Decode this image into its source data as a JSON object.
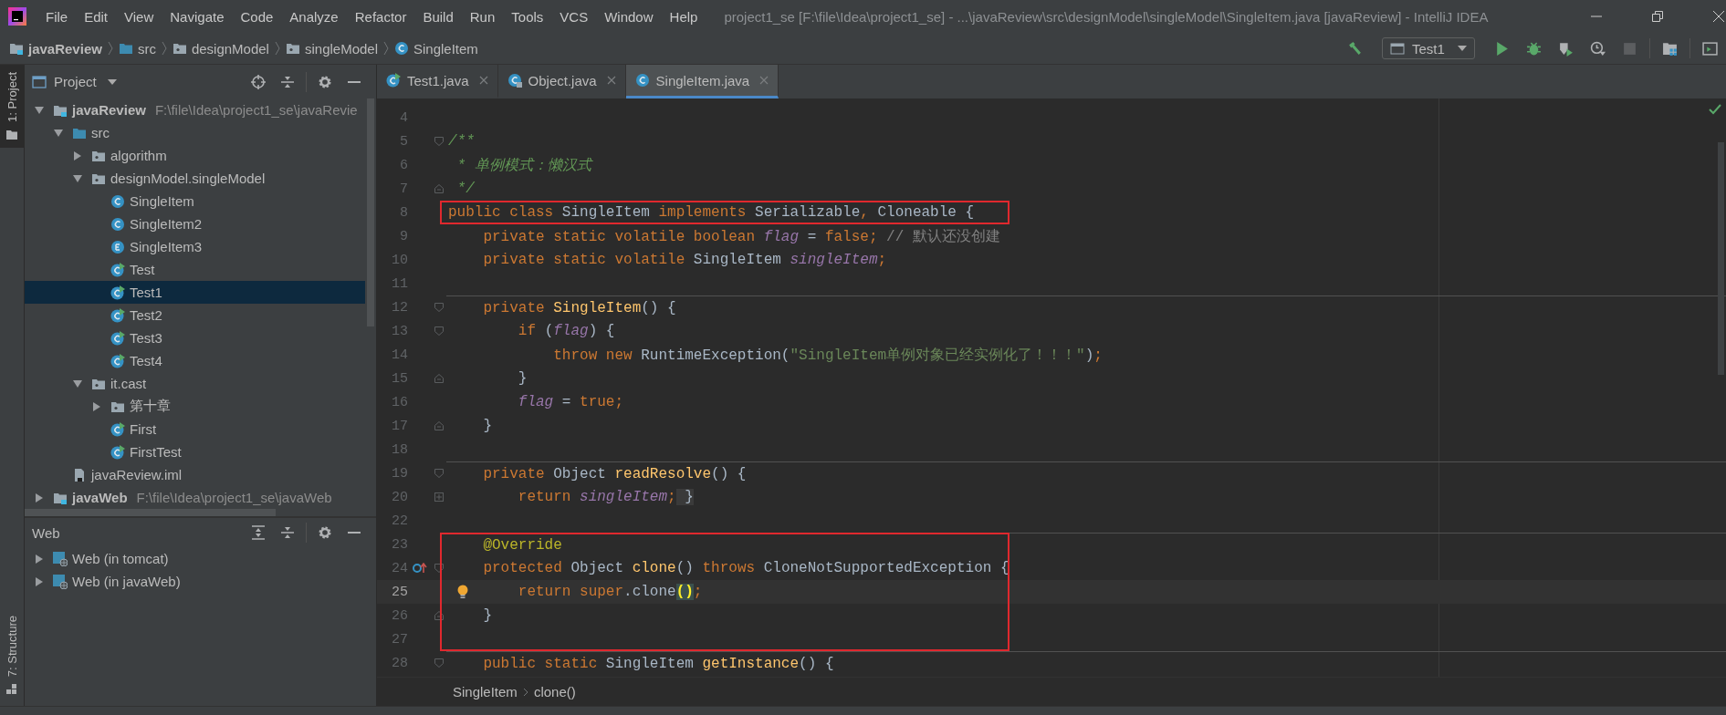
{
  "window": {
    "title": "project1_se [F:\\file\\Idea\\project1_se] - ...\\javaReview\\src\\designModel\\singleModel\\SingleItem.java [javaReview] - IntelliJ IDEA",
    "menu": [
      "File",
      "Edit",
      "View",
      "Navigate",
      "Code",
      "Analyze",
      "Refactor",
      "Build",
      "Run",
      "Tools",
      "VCS",
      "Window",
      "Help"
    ]
  },
  "nav_bar": {
    "breadcrumbs": [
      {
        "label": "javaReview",
        "kind": "module"
      },
      {
        "label": "src",
        "kind": "source-folder"
      },
      {
        "label": "designModel",
        "kind": "package"
      },
      {
        "label": "singleModel",
        "kind": "package"
      },
      {
        "label": "SingleItem",
        "kind": "class"
      }
    ],
    "run_config": "Test1"
  },
  "tool_strip": {
    "tabs": [
      {
        "label": "1: Project",
        "selected": true
      },
      {
        "label": "7: Structure",
        "selected": false
      }
    ]
  },
  "project_panel": {
    "title": "Project",
    "tree": [
      {
        "label": "javaReview",
        "kind": "module",
        "path": "F:\\file\\Idea\\project1_se\\javaRevie",
        "expanded": true,
        "selected": false,
        "children": [
          {
            "label": "src",
            "kind": "source-folder",
            "expanded": true,
            "selected": false,
            "children": [
              {
                "label": "algorithm",
                "kind": "package",
                "expanded": false,
                "selected": false
              },
              {
                "label": "designModel.singleModel",
                "kind": "package",
                "expanded": true,
                "selected": false,
                "children": [
                  {
                    "label": "SingleItem",
                    "kind": "class",
                    "selected": false
                  },
                  {
                    "label": "SingleItem2",
                    "kind": "class",
                    "selected": false
                  },
                  {
                    "label": "SingleItem3",
                    "kind": "enum",
                    "selected": false
                  },
                  {
                    "label": "Test",
                    "kind": "runnable",
                    "selected": false
                  },
                  {
                    "label": "Test1",
                    "kind": "runnable",
                    "selected": true
                  },
                  {
                    "label": "Test2",
                    "kind": "runnable",
                    "selected": false
                  },
                  {
                    "label": "Test3",
                    "kind": "runnable",
                    "selected": false
                  },
                  {
                    "label": "Test4",
                    "kind": "runnable",
                    "selected": false
                  }
                ]
              },
              {
                "label": "it.cast",
                "kind": "package",
                "expanded": true,
                "selected": false,
                "children": [
                  {
                    "label": "第十章",
                    "kind": "package",
                    "expanded": false,
                    "selected": false
                  },
                  {
                    "label": "First",
                    "kind": "runnable",
                    "selected": false
                  },
                  {
                    "label": "FirstTest",
                    "kind": "runnable",
                    "selected": false
                  }
                ]
              }
            ]
          },
          {
            "label": "javaReview.iml",
            "kind": "iml",
            "selected": false
          }
        ]
      },
      {
        "label": "javaWeb",
        "kind": "module",
        "path": "F:\\file\\Idea\\project1_se\\javaWeb",
        "expanded": false,
        "selected": false
      }
    ]
  },
  "web_panel": {
    "title": "Web",
    "items": [
      {
        "label": "Web (in tomcat)",
        "expanded": false
      },
      {
        "label": "Web (in javaWeb)",
        "expanded": false
      }
    ]
  },
  "editor": {
    "tabs": [
      {
        "label": "Test1.java",
        "kind": "runnable",
        "selected": false
      },
      {
        "label": "Object.java",
        "kind": "locked-class",
        "selected": false
      },
      {
        "label": "SingleItem.java",
        "kind": "class",
        "selected": true
      }
    ],
    "lines": [
      {
        "number": "4"
      },
      {
        "number": "5",
        "fold_start": true,
        "tokens": [
          {
            "text": "/**",
            "kind": "doc"
          }
        ]
      },
      {
        "number": "6",
        "tokens": [
          {
            "text": " * 单例模式：懒汉式",
            "kind": "doc"
          }
        ]
      },
      {
        "number": "7",
        "fold_end": true,
        "tokens": [
          {
            "text": " */",
            "kind": "doc"
          }
        ]
      },
      {
        "number": "8",
        "boxed": true,
        "tokens": [
          {
            "text": "public class ",
            "kind": "kw"
          },
          {
            "text": "SingleItem ",
            "kind": "plain"
          },
          {
            "text": "implements ",
            "kind": "kw"
          },
          {
            "text": "Serializable",
            "kind": "plain"
          },
          {
            "text": ", ",
            "kind": "kw"
          },
          {
            "text": "Cloneable {",
            "kind": "plain"
          }
        ]
      },
      {
        "number": "9",
        "tokens": [
          {
            "text": "    private static volatile boolean ",
            "kind": "kw"
          },
          {
            "text": "flag",
            "kind": "field"
          },
          {
            "text": " = ",
            "kind": "plain"
          },
          {
            "text": "false;",
            "kind": "kw"
          },
          {
            "text": " // 默认还没创建",
            "kind": "cmt"
          }
        ]
      },
      {
        "number": "10",
        "tokens": [
          {
            "text": "    private static volatile ",
            "kind": "kw"
          },
          {
            "text": "SingleItem ",
            "kind": "plain"
          },
          {
            "text": "singleItem",
            "kind": "field"
          },
          {
            "text": ";",
            "kind": "kw"
          }
        ]
      },
      {
        "number": "11"
      },
      {
        "number": "12",
        "separator": true,
        "fold_start": true,
        "tokens": [
          {
            "text": "    private ",
            "kind": "kw"
          },
          {
            "text": "SingleItem",
            "kind": "fn"
          },
          {
            "text": "() {",
            "kind": "plain"
          }
        ]
      },
      {
        "number": "13",
        "fold_start": true,
        "tokens": [
          {
            "text": "        if ",
            "kind": "kw"
          },
          {
            "text": "(",
            "kind": "plain"
          },
          {
            "text": "flag",
            "kind": "field"
          },
          {
            "text": ") {",
            "kind": "plain"
          }
        ]
      },
      {
        "number": "14",
        "tokens": [
          {
            "text": "            throw new ",
            "kind": "kw"
          },
          {
            "text": "RuntimeException(",
            "kind": "plain"
          },
          {
            "text": "\"SingleItem单例对象已经实例化了！！！\"",
            "kind": "str"
          },
          {
            "text": ")",
            "kind": "plain"
          },
          {
            "text": ";",
            "kind": "kw"
          }
        ]
      },
      {
        "number": "15",
        "fold_end": true,
        "tokens": [
          {
            "text": "        }",
            "kind": "plain"
          }
        ]
      },
      {
        "number": "16",
        "tokens": [
          {
            "text": "        flag",
            "kind": "field"
          },
          {
            "text": " = ",
            "kind": "plain"
          },
          {
            "text": "true;",
            "kind": "kw"
          }
        ]
      },
      {
        "number": "17",
        "fold_end": true,
        "tokens": [
          {
            "text": "    }",
            "kind": "plain"
          }
        ]
      },
      {
        "number": "18"
      },
      {
        "number": "19",
        "separator": true,
        "fold_start": true,
        "tokens": [
          {
            "text": "    private ",
            "kind": "kw"
          },
          {
            "text": "Object ",
            "kind": "plain"
          },
          {
            "text": "readResolve",
            "kind": "fn"
          },
          {
            "text": "() {",
            "kind": "plain"
          }
        ]
      },
      {
        "number": "20",
        "folded": true,
        "tokens": [
          {
            "text": "        return ",
            "kind": "kw"
          },
          {
            "text": "singleItem",
            "kind": "field"
          },
          {
            "text": ";",
            "kind": "kw"
          },
          {
            "text": " }",
            "kind": "folded"
          }
        ]
      },
      {
        "number": "22"
      },
      {
        "number": "23",
        "separator": true,
        "boxed": true,
        "tokens": [
          {
            "text": "    @Override",
            "kind": "annot"
          }
        ]
      },
      {
        "number": "24",
        "boxed": true,
        "overrides": true,
        "fold_start": true,
        "tokens": [
          {
            "text": "    protected ",
            "kind": "kw"
          },
          {
            "text": "Object ",
            "kind": "plain"
          },
          {
            "text": "clone",
            "kind": "fn"
          },
          {
            "text": "() ",
            "kind": "plain"
          },
          {
            "text": "throws ",
            "kind": "kw"
          },
          {
            "text": "CloneNotSupportedException {",
            "kind": "plain"
          }
        ]
      },
      {
        "number": "25",
        "boxed": true,
        "current": true,
        "bulb": true,
        "tokens": [
          {
            "text": "        return super",
            "kind": "kw"
          },
          {
            "text": ".clone",
            "kind": "plain"
          },
          {
            "text": "()",
            "kind": "matched"
          },
          {
            "text": ";",
            "kind": "kw"
          }
        ]
      },
      {
        "number": "26",
        "boxed": true,
        "fold_end": true,
        "tokens": [
          {
            "text": "    }",
            "kind": "plain"
          }
        ]
      },
      {
        "number": "27",
        "boxed": true
      },
      {
        "number": "28",
        "separator": true,
        "fold_start": true,
        "tokens": [
          {
            "text": "    public static ",
            "kind": "kw"
          },
          {
            "text": "SingleItem ",
            "kind": "plain"
          },
          {
            "text": "getInstance",
            "kind": "fn"
          },
          {
            "text": "() {",
            "kind": "plain"
          }
        ]
      }
    ],
    "breadcrumbs": [
      "SingleItem",
      "clone()"
    ]
  }
}
